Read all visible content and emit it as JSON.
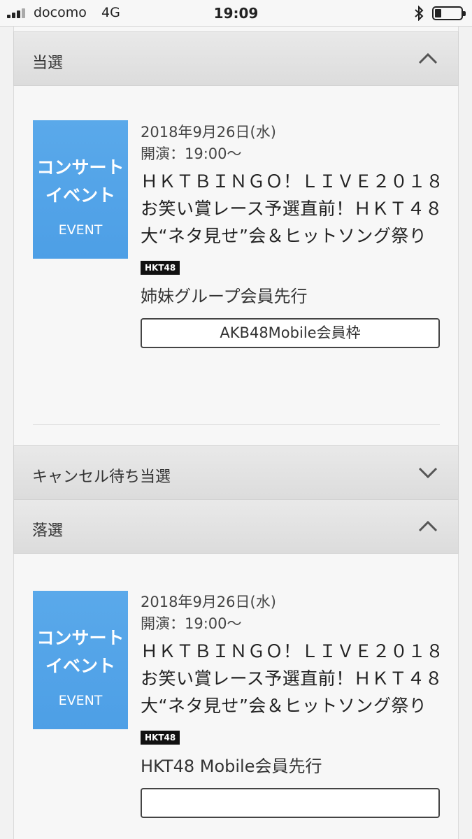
{
  "status_bar": {
    "carrier": "docomo",
    "network": "4G",
    "time": "19:09"
  },
  "sections": [
    {
      "title": "当選",
      "expanded": true
    },
    {
      "title": "キャンセル待ち当選",
      "expanded": false
    },
    {
      "title": "落選",
      "expanded": true
    }
  ],
  "cards": [
    {
      "thumb_line1": "コンサート",
      "thumb_line2": "イベント",
      "thumb_en": "EVENT",
      "date": "2018年9月26日(水)",
      "time": "開演：19:00〜",
      "title": "ＨＫＴＢＩＮＧＯ！ＬＩＶＥ２０１８ お笑い賞レース予選直前！ＨＫＴ４８大“ネタ見せ”会＆ヒットソング祭り",
      "tag": "HKT48",
      "group": "姉妹グループ会員先行",
      "button": "AKB48Mobile会員枠"
    },
    {
      "thumb_line1": "コンサート",
      "thumb_line2": "イベント",
      "thumb_en": "EVENT",
      "date": "2018年9月26日(水)",
      "time": "開演：19:00〜",
      "title": "ＨＫＴＢＩＮＧＯ！ＬＩＶＥ２０１８ お笑い賞レース予選直前！ＨＫＴ４８大“ネタ見せ”会＆ヒットソング祭り",
      "tag": "HKT48",
      "group": "HKT48 Mobile会員先行",
      "button": ""
    }
  ],
  "colors": {
    "thumb_blue": "#4d9fe6",
    "header_bg": "#e2e2e2"
  }
}
